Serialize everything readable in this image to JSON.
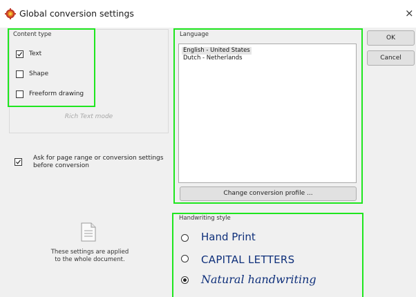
{
  "window": {
    "title": "Global conversion settings",
    "close_glyph": "×",
    "icon": "app-gear-icon"
  },
  "content_type": {
    "label": "Content type",
    "items": [
      {
        "label": "Text",
        "checked": true
      },
      {
        "label": "Shape",
        "checked": false
      },
      {
        "label": "Freeform drawing",
        "checked": false
      }
    ],
    "rich_text_mode": "Rich Text mode"
  },
  "ask": {
    "line1": "Ask for page range or conversion settings",
    "line2": "before conversion",
    "checked": true
  },
  "info": {
    "icon": "document-icon",
    "line1": "These settings are applied",
    "line2": "to the whole document."
  },
  "language": {
    "label": "Language",
    "items": [
      {
        "label": "English - United States",
        "selected": true
      },
      {
        "label": "Dutch - Netherlands",
        "selected": false
      }
    ],
    "profile_button": "Change conversion profile ..."
  },
  "buttons": {
    "ok": "OK",
    "cancel": "Cancel"
  },
  "handwriting": {
    "label": "Handwriting style",
    "options": [
      {
        "label": "Hand Print",
        "selected": false
      },
      {
        "label": "CAPITAL LETTERS",
        "selected": false
      },
      {
        "label": "Natural handwriting",
        "selected": true
      }
    ]
  },
  "colors": {
    "highlight": "#1ee61e",
    "handwriting_text": "#0e2f7a"
  }
}
